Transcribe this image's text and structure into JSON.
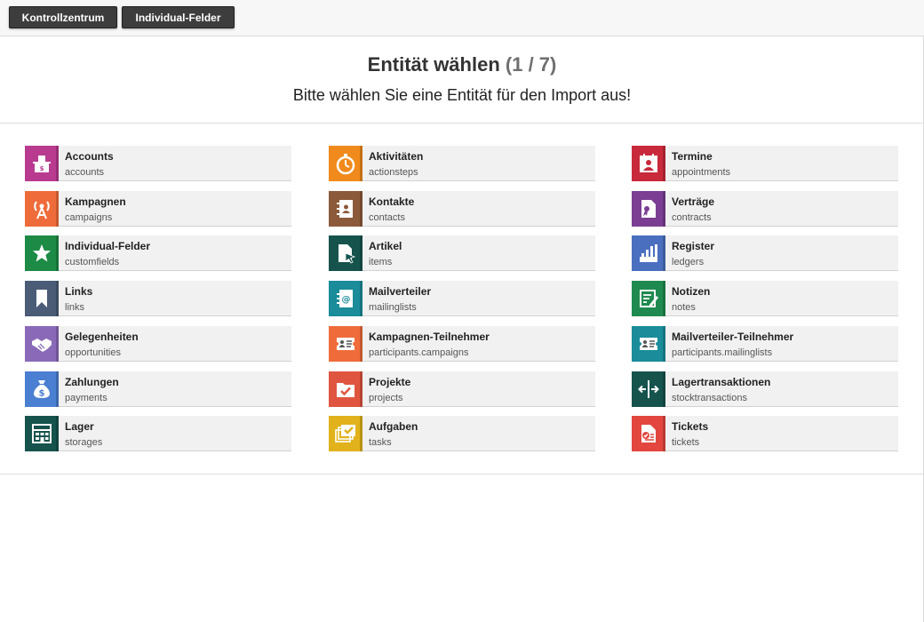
{
  "toolbar": {
    "buttons": [
      "Kontrollzentrum",
      "Individual-Felder"
    ]
  },
  "header": {
    "title": "Entität wählen",
    "step": "(1 / 7)",
    "subtitle": "Bitte wählen Sie eine Entität für den Import aus!"
  },
  "entities": [
    {
      "label": "Accounts",
      "key": "accounts",
      "color": "#b83b8f",
      "icon": "cash-register-icon"
    },
    {
      "label": "Aktivitäten",
      "key": "actionsteps",
      "color": "#f08a1c",
      "icon": "stopwatch-icon"
    },
    {
      "label": "Termine",
      "key": "appointments",
      "color": "#c8293b",
      "icon": "calendar-person-icon"
    },
    {
      "label": "Kampagnen",
      "key": "campaigns",
      "color": "#ef6c3a",
      "icon": "broadcast-icon"
    },
    {
      "label": "Kontakte",
      "key": "contacts",
      "color": "#8b5a3a",
      "icon": "address-book-icon"
    },
    {
      "label": "Verträge",
      "key": "contracts",
      "color": "#7b3e93",
      "icon": "contract-icon"
    },
    {
      "label": "Individual-Felder",
      "key": "customfields",
      "color": "#1d8a45",
      "icon": "star-icon"
    },
    {
      "label": "Artikel",
      "key": "items",
      "color": "#16534d",
      "icon": "document-cursor-icon"
    },
    {
      "label": "Register",
      "key": "ledgers",
      "color": "#4a6fbf",
      "icon": "ledger-chart-icon"
    },
    {
      "label": "Links",
      "key": "links",
      "color": "#4a5c76",
      "icon": "bookmark-icon"
    },
    {
      "label": "Mailverteiler",
      "key": "mailinglists",
      "color": "#1a8c9a",
      "icon": "mail-notebook-icon"
    },
    {
      "label": "Notizen",
      "key": "notes",
      "color": "#1f8a4f",
      "icon": "note-pencil-icon"
    },
    {
      "label": "Gelegenheiten",
      "key": "opportunities",
      "color": "#8a6ab8",
      "icon": "handshake-icon"
    },
    {
      "label": "Kampagnen-Teilnehmer",
      "key": "participants.campaigns",
      "color": "#ef6c3a",
      "icon": "ticket-person-icon"
    },
    {
      "label": "Mailverteiler-Teilnehmer",
      "key": "participants.mailinglists",
      "color": "#1a8c9a",
      "icon": "ticket-person-icon"
    },
    {
      "label": "Zahlungen",
      "key": "payments",
      "color": "#4a7fd1",
      "icon": "money-bag-icon"
    },
    {
      "label": "Projekte",
      "key": "projects",
      "color": "#e0553f",
      "icon": "folder-check-icon"
    },
    {
      "label": "Lagertransaktionen",
      "key": "stocktransactions",
      "color": "#16534d",
      "icon": "transfer-arrows-icon"
    },
    {
      "label": "Lager",
      "key": "storages",
      "color": "#16534d",
      "icon": "warehouse-icon"
    },
    {
      "label": "Aufgaben",
      "key": "tasks",
      "color": "#e2b21c",
      "icon": "tasks-check-icon"
    },
    {
      "label": "Tickets",
      "key": "tickets",
      "color": "#e2463f",
      "icon": "ticket-document-icon"
    }
  ]
}
